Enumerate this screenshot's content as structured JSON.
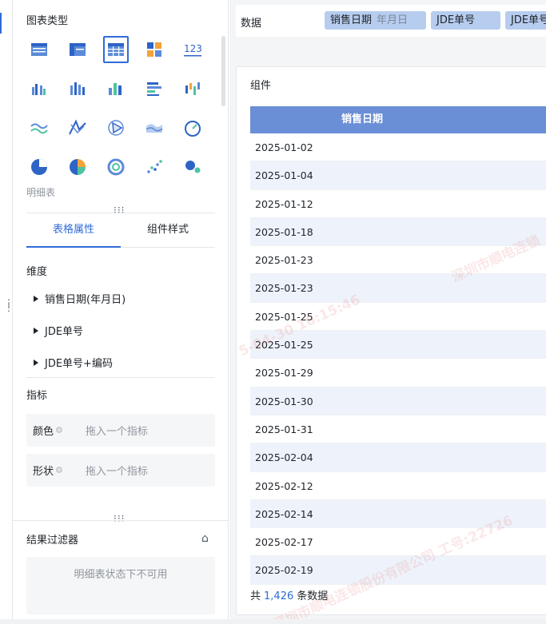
{
  "panel": {
    "chart_type_title": "图表类型",
    "chart_types": [
      [
        "table-icon",
        "cross-table-icon",
        "detail-table-icon",
        "kpi-grid-icon",
        "number-icon"
      ],
      [
        "grouped-bar-icon",
        "stacked-bar-icon",
        "column-icon",
        "horizontal-bar-icon",
        "range-bar-icon"
      ],
      [
        "line-icon",
        "flow-line-icon",
        "radar-icon",
        "area-icon",
        "gauge-icon"
      ],
      [
        "pie-icon",
        "donut-pie-icon",
        "ring-icon",
        "scatter-icon",
        "bubble-icon"
      ]
    ],
    "selected_type_label": "明细表",
    "tabs": [
      "表格属性",
      "组件样式"
    ],
    "dimension_title": "维度",
    "dimensions": [
      "销售日期(年月日)",
      "JDE单号",
      "JDE单号+编码"
    ],
    "metric_title": "指标",
    "metrics": [
      {
        "label": "颜色",
        "placeholder": "拖入一个指标"
      },
      {
        "label": "形状",
        "placeholder": "拖入一个指标"
      }
    ],
    "filter_title": "结果过滤器",
    "filter_empty": "明细表状态下不可用"
  },
  "data_bar": {
    "label": "数据",
    "pills": [
      {
        "name": "销售日期",
        "sub": "年月日"
      },
      {
        "name": "JDE单号",
        "sub": ""
      },
      {
        "name": "JDE单号",
        "sub": ""
      }
    ]
  },
  "card": {
    "title": "组件",
    "column_header": "销售日期",
    "rows": [
      "2025-01-02",
      "2025-01-04",
      "2025-01-12",
      "2025-01-18",
      "2025-01-23",
      "2025-01-23",
      "2025-01-25",
      "2025-01-25",
      "2025-01-29",
      "2025-01-30",
      "2025-01-31",
      "2025-02-04",
      "2025-02-12",
      "2025-02-14",
      "2025-02-17",
      "2025-02-19"
    ],
    "count_prefix": "共",
    "count_value": "1,426",
    "count_suffix": "条数据"
  },
  "watermarks": [
    "5-04-30 16:15:46",
    "深圳市顺电连锁",
    "深圳市顺电连锁股份有限公司 工号:22726"
  ],
  "colors": {
    "accent": "#2f6bd8",
    "table_header": "#6b8fd6",
    "pill": "#b7cdef"
  }
}
